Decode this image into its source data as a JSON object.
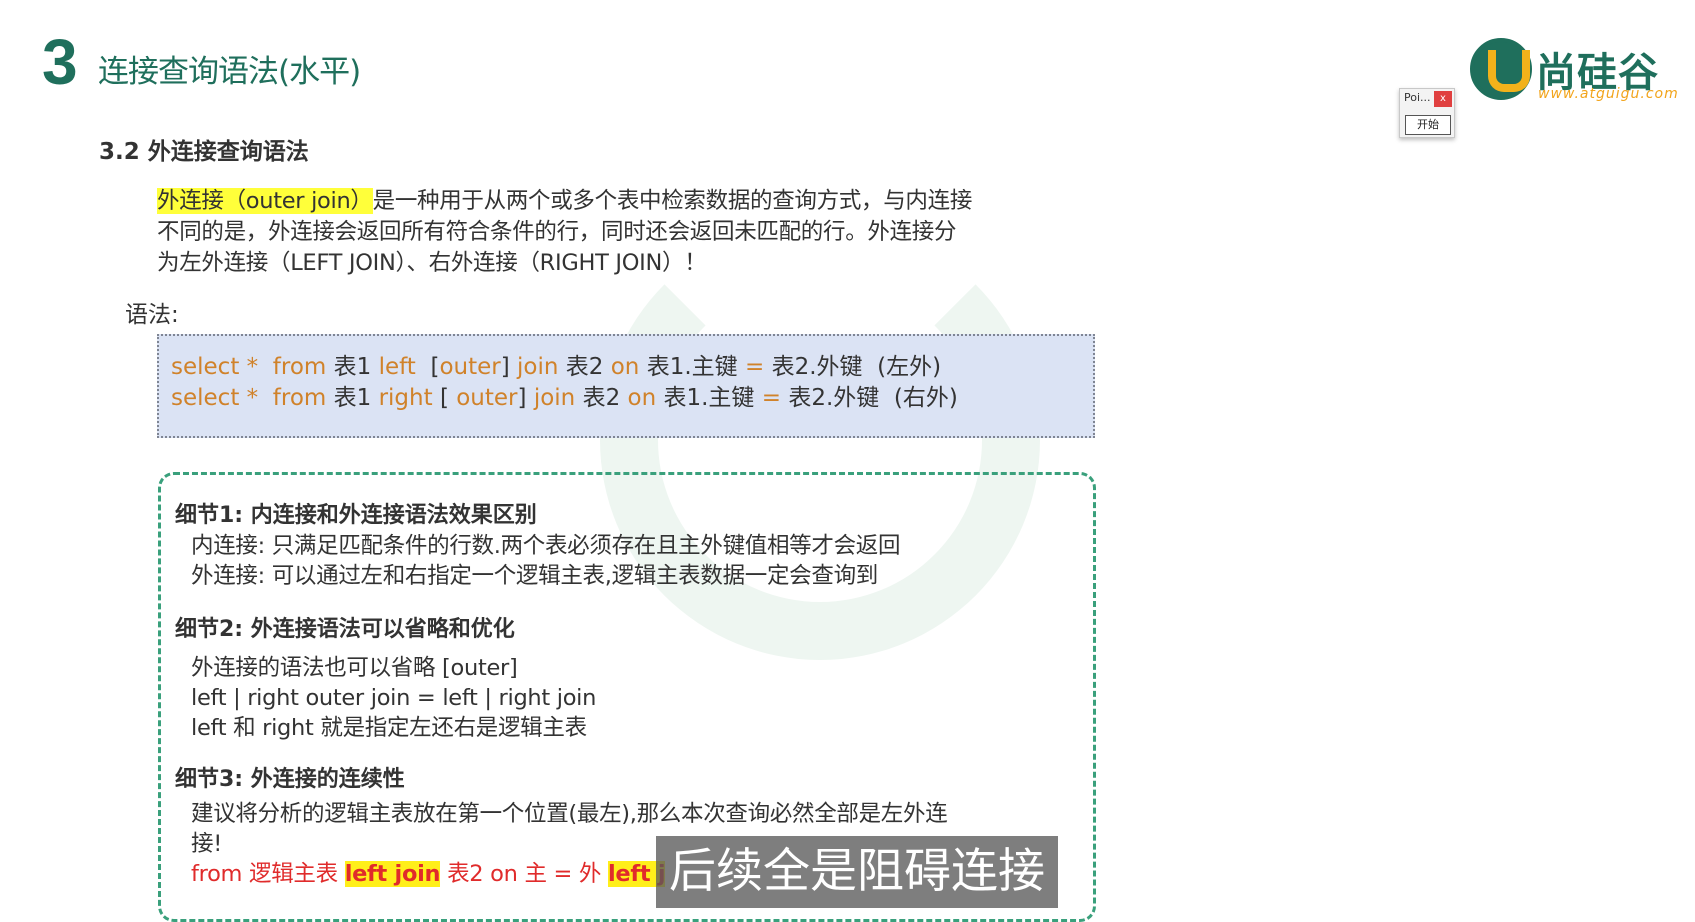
{
  "header": {
    "slide_number": "3",
    "title": "连接查询语法(水平)",
    "logo_name": "尚硅谷",
    "logo_url": "www.atguigu.com"
  },
  "widget": {
    "label": "Poi...",
    "close": "x",
    "start_button": "开始"
  },
  "section": {
    "heading": "3.2 外连接查询语法",
    "paragraph_highlight": "外连接（outer join）",
    "paragraph_line1_rest": "是一种用于从两个或多个表中检索数据的查询方式，与内连接",
    "paragraph_line2": "不同的是，外连接会返回所有符合条件的行，同时还会返回未匹配的行。外连接分",
    "paragraph_line3": "为左外连接（LEFT JOIN）、右外连接（RIGHT JOIN）！",
    "syntax_label": "语法:"
  },
  "code": {
    "line1": {
      "select": "select",
      "star": "*",
      "from": "from",
      "t1": "表1",
      "join_type": "left",
      "outer_open": "[",
      "outer": "outer",
      "outer_close": "]",
      "join": "join",
      "t2": "表2",
      "on": "on",
      "lhs": "表1.主键",
      "eq": "=",
      "rhs": "表2.外键",
      "note": "(左外)"
    },
    "line2": {
      "select": "select",
      "star": "*",
      "from": "from",
      "t1": "表1",
      "join_type": "right",
      "outer_open": "[",
      "outer": "outer",
      "outer_close": "]",
      "join": "join",
      "t2": "表2",
      "on": "on",
      "lhs": "表1.主键",
      "eq": "=",
      "rhs": "表2.外键",
      "note": "(右外)"
    }
  },
  "details": {
    "d1_title": "细节1:  内连接和外连接语法效果区别",
    "d1_line1": "内连接: 只满足匹配条件的行数.两个表必须存在且主外键值相等才会返回",
    "d1_line2": "外连接: 可以通过左和右指定一个逻辑主表,逻辑主表数据一定会查询到",
    "d2_title": "细节2: 外连接语法可以省略和优化",
    "d2_line1": "外连接的语法也可以省略 [outer]",
    "d2_line2": "left | right outer join  = left | right join",
    "d2_line3": "left 和 right 就是指定左还右是逻辑主表",
    "d3_title": "细节3: 外连接的连续性",
    "d3_line1": "建议将分析的逻辑主表放在第一个位置(最左),那么本次查询必然全部是左外连",
    "d3_line2": "接!",
    "d3_code_from": "from 逻辑主表",
    "d3_code_join1": "left join",
    "d3_code_mid": "表2 on 主 = 外",
    "d3_code_join2": "left j"
  },
  "subtitle": {
    "text": "后续全是阻碍连接"
  },
  "colors": {
    "brand_green": "#1f6f5c",
    "keyword_orange": "#d0822a",
    "highlight_yellow": "#ffff3a",
    "code_bg": "#dbe3f4",
    "dashed_border": "#3aa07c",
    "red_text": "#e02b2b"
  }
}
